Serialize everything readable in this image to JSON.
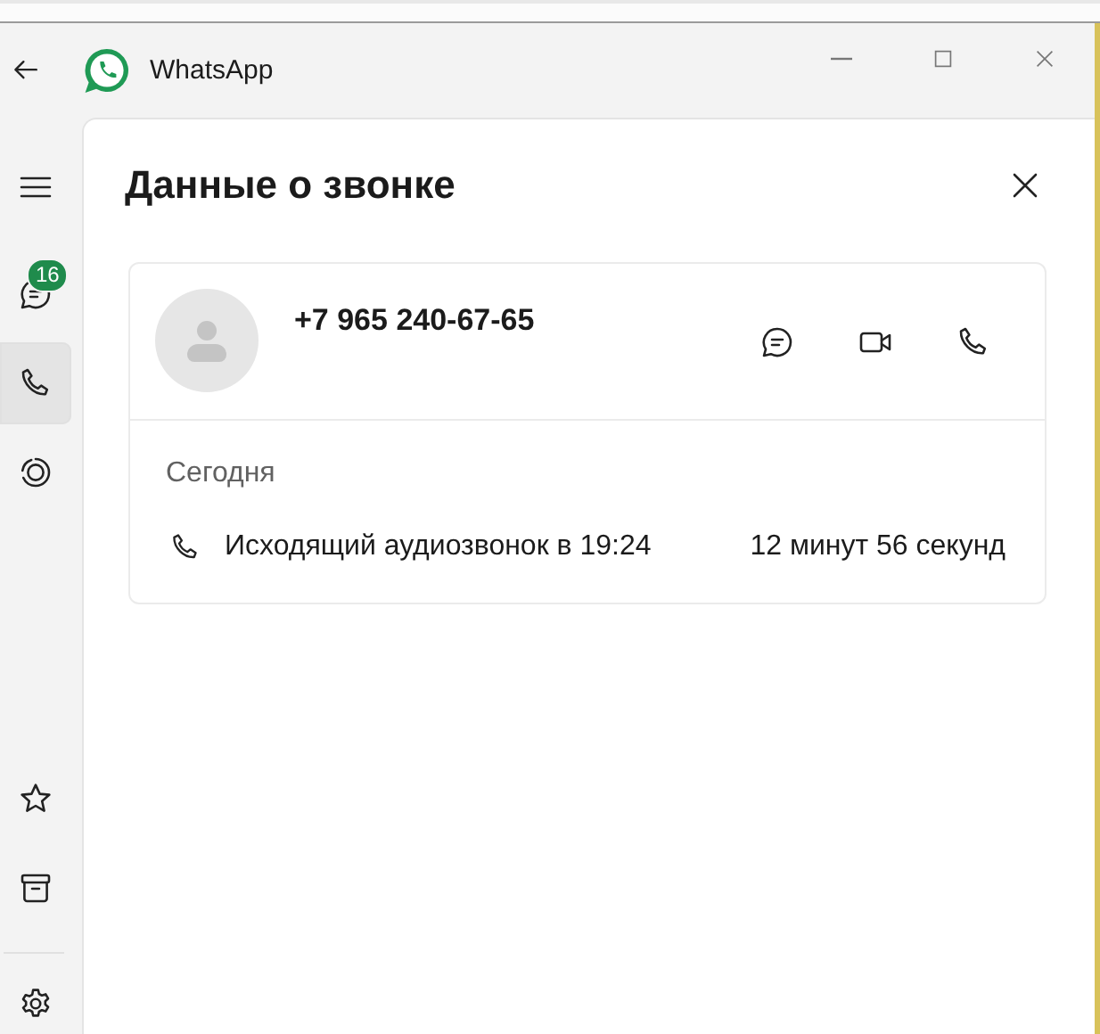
{
  "window": {
    "title": "WhatsApp"
  },
  "nav": [
    {
      "kind": "menu",
      "selected": false
    },
    {
      "kind": "chats",
      "selected": false,
      "badge": "16"
    },
    {
      "kind": "calls",
      "selected": true
    },
    {
      "kind": "status",
      "selected": false
    }
  ],
  "nav_bottom": [
    {
      "kind": "starred",
      "selected": false
    },
    {
      "kind": "archive",
      "selected": false
    },
    {
      "kind": "settings",
      "selected": false
    }
  ],
  "panel": {
    "title": "Данные о звонке",
    "contact": {
      "phone": "+7 965 240-67-65",
      "actions": [
        {
          "kind": "message"
        },
        {
          "kind": "video"
        },
        {
          "kind": "voice"
        }
      ]
    },
    "section": "Сегодня",
    "calls": [
      {
        "kind": "outgoing-audio",
        "label": "Исходящий аудиозвонок в 19:24",
        "duration": "12 минут 56 секунд"
      }
    ]
  }
}
